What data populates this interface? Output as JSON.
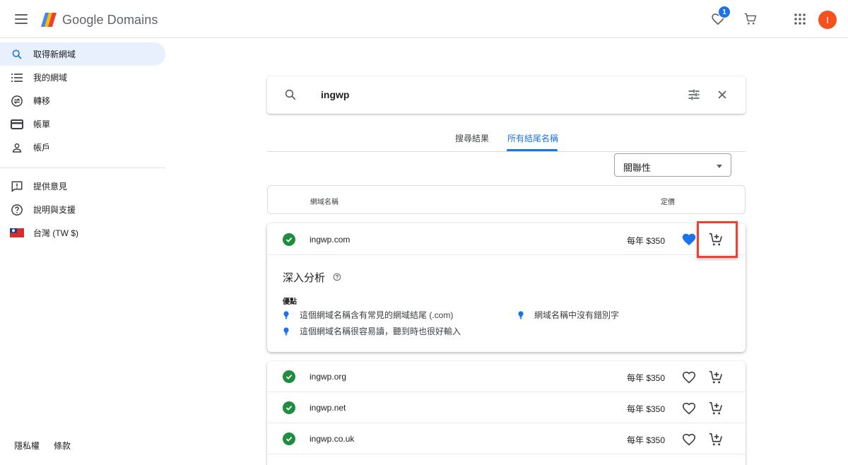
{
  "header": {
    "app_name": "Google Domains",
    "favorites_count": "1",
    "avatar_initial": "I",
    "icons": [
      "menu-icon",
      "heart-icon",
      "cart-icon",
      "apps-icon"
    ]
  },
  "sidebar": {
    "items": [
      {
        "label": "取得新網域",
        "icon": "search-icon",
        "active": true
      },
      {
        "label": "我的網域",
        "icon": "list-icon"
      },
      {
        "label": "轉移",
        "icon": "transfer-icon"
      },
      {
        "label": "帳單",
        "icon": "credit-card-icon"
      },
      {
        "label": "帳戶",
        "icon": "person-icon"
      }
    ],
    "secondary": [
      {
        "label": "提供意見",
        "icon": "feedback-icon"
      },
      {
        "label": "說明與支援",
        "icon": "help-icon"
      },
      {
        "label": "台灣 (TW $)",
        "icon": "taiwan-flag-icon"
      }
    ],
    "footer": {
      "privacy": "隱私權",
      "terms": "條款"
    }
  },
  "search": {
    "query": "ingwp"
  },
  "tabs": [
    {
      "label": "搜尋結果",
      "active": false
    },
    {
      "label": "所有結尾名稱",
      "active": true
    }
  ],
  "sort": {
    "selected": "關聯性"
  },
  "table": {
    "col_name": "網域名稱",
    "col_price": "定價"
  },
  "featured": {
    "domain": "ingwp.com",
    "price": "每年 $350",
    "favorited": true,
    "insights_title": "深入分析",
    "pros_label": "優點",
    "pros": [
      "這個網域名稱含有常見的網域結尾 (.com)",
      "網域名稱中沒有錯別字",
      "這個網域名稱很容易讀，聽到時也很好輸入"
    ]
  },
  "results": [
    {
      "domain": "ingwp.org",
      "price": "每年 $350"
    },
    {
      "domain": "ingwp.net",
      "price": "每年 $350"
    },
    {
      "domain": "ingwp.co.uk",
      "price": "每年 $350"
    }
  ],
  "colors": {
    "accent": "#1a73e8",
    "available": "#1e8e3e",
    "avatar": "#f4511e",
    "highlight": "#ea4335"
  }
}
